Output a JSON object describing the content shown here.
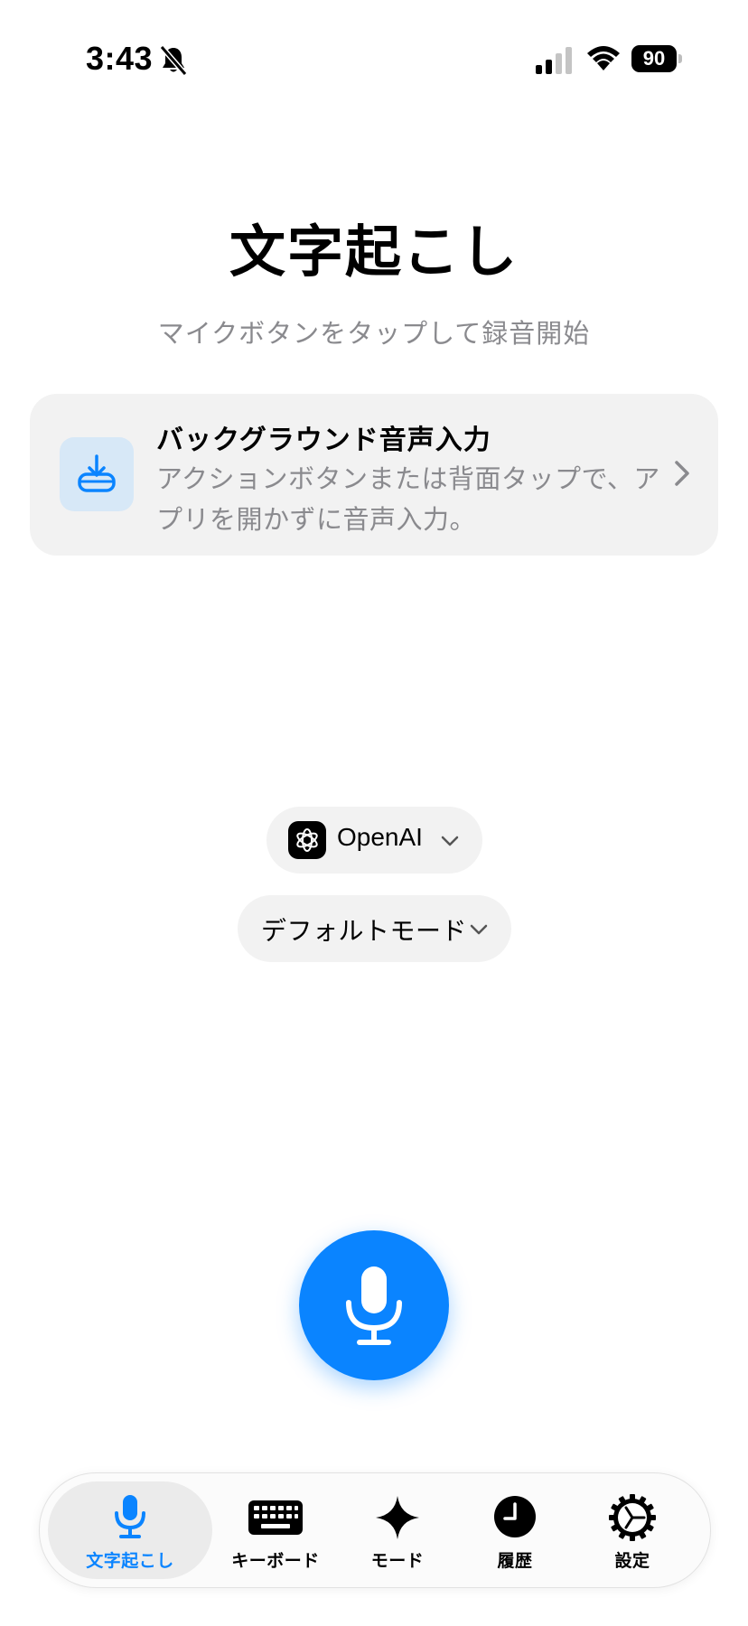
{
  "status_bar": {
    "time": "3:43",
    "battery": "90"
  },
  "header": {
    "title": "文字起こし",
    "subtitle": "マイクボタンをタップして録音開始"
  },
  "banner": {
    "title": "バックグラウンド音声入力",
    "description": "アクションボタンまたは背面タップで、アプリを開かずに音声入力。",
    "icon": "tray-download-icon"
  },
  "model_selector": {
    "label": "OpenAI",
    "icon": "openai-logo-icon"
  },
  "mode_selector": {
    "label": "デフォルトモード"
  },
  "record_button": {
    "icon": "microphone-icon"
  },
  "tab_bar": {
    "items": [
      {
        "label": "文字起こし",
        "icon": "microphone-icon",
        "active": true
      },
      {
        "label": "キーボード",
        "icon": "keyboard-icon",
        "active": false
      },
      {
        "label": "モード",
        "icon": "sparkle-icon",
        "active": false
      },
      {
        "label": "履歴",
        "icon": "clock-icon",
        "active": false
      },
      {
        "label": "設定",
        "icon": "gear-icon",
        "active": false
      }
    ]
  },
  "colors": {
    "accent": "#0a84ff",
    "secondary_text": "#8a8a8e",
    "card_background": "#f2f2f2"
  }
}
